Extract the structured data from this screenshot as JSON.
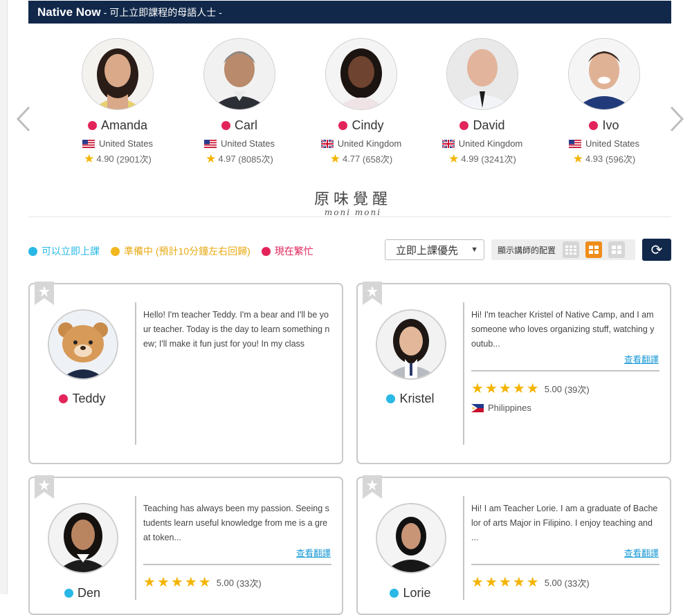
{
  "header": {
    "brand": "Native Now",
    "subtitle": "- 可上立即課程的母語人士 -"
  },
  "featured": [
    {
      "name": "Amanda",
      "status": "busy",
      "country": "United States",
      "flag": "us",
      "rating": "4.90",
      "count": "(2901次)"
    },
    {
      "name": "Carl",
      "status": "busy",
      "country": "United States",
      "flag": "us",
      "rating": "4.97",
      "count": "(8085次)"
    },
    {
      "name": "Cindy",
      "status": "busy",
      "country": "United Kingdom",
      "flag": "uk",
      "rating": "4.77",
      "count": "(658次)"
    },
    {
      "name": "David",
      "status": "busy",
      "country": "United Kingdom",
      "flag": "uk",
      "rating": "4.99",
      "count": "(3241次)"
    },
    {
      "name": "Ivo",
      "status": "busy",
      "country": "United States",
      "flag": "us",
      "rating": "4.93",
      "count": "(596次)"
    }
  ],
  "logo": {
    "main": "原味覺醒",
    "sub": "moni moni"
  },
  "legend": {
    "available": "可以立即上課",
    "preparing": "準備中 (預計10分鐘左右回歸)",
    "busy": "現在繁忙"
  },
  "controls": {
    "sort_value": "立即上課優先",
    "layout_label": "顯示講師的配置"
  },
  "colors": {
    "navy": "#11284a",
    "busy": "#e2245a",
    "available": "#28b8e6",
    "preparing": "#f2b71f",
    "accent": "#f08c1a",
    "link": "#1a9ad6"
  },
  "teachers": [
    {
      "name": "Teddy",
      "status": "busy",
      "bio": "Hello! I'm teacher Teddy. I'm a bear and I'll be your teacher. Today is the day to learn something new; I'll make it fun just for you! In my class"
    },
    {
      "name": "Kristel",
      "status": "available",
      "bio": "Hi! I'm teacher Kristel of Native Camp, and I am someone who loves organizing stuff, watching youtub...",
      "translate": "查看翻譯",
      "rating": "5.00",
      "count": "(39次)",
      "country": "Philippines"
    },
    {
      "name": "Den",
      "status": "available",
      "bio": "Teaching has always been my passion. Seeing students learn useful knowledge from me is a great token...",
      "translate": "查看翻譯",
      "rating": "5.00",
      "count": "(33次)"
    },
    {
      "name": "Lorie",
      "status": "available",
      "bio": "Hi! I am Teacher Lorie. I am a graduate of Bachelor of arts Major in Filipino. I enjoy teaching and ...",
      "translate": "查看翻譯",
      "rating": "5.00",
      "count": "(33次)"
    }
  ]
}
